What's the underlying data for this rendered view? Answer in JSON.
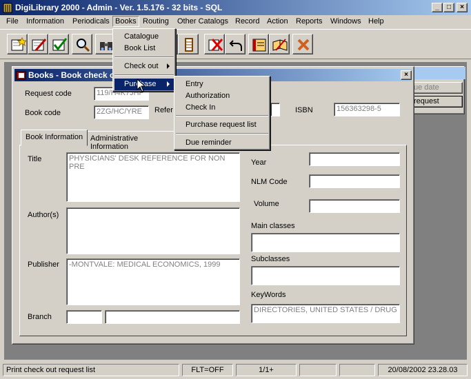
{
  "app": {
    "title": "DigiLibrary 2000 - Admin - Ver. 1.5.176 - 32 bits - SQL",
    "controls": {
      "minimize": "_",
      "maximize": "□",
      "close": "×"
    }
  },
  "menubar": [
    "File",
    "Information",
    "Periodicals",
    "Books",
    "Routing",
    "Other Catalogs",
    "Record",
    "Action",
    "Reports",
    "Windows",
    "Help"
  ],
  "toolbar": {
    "icons": [
      "new-card-icon",
      "edit-card-icon",
      "check-card-icon",
      "magnifier-icon",
      "binoculars-icon",
      "tool-icon",
      "filmstrip-icon",
      "delete-icon",
      "undo-icon",
      "book-icon",
      "open-book-icon",
      "cancel-icon"
    ]
  },
  "books_menu": {
    "items": [
      "Catalogue",
      "Book List",
      "Check out",
      "Purchase"
    ]
  },
  "purchase_menu": {
    "items": [
      "Entry",
      "Authorization",
      "Check In",
      "Purchase request list",
      "Due reminder"
    ]
  },
  "bg_window": {
    "buttons": [
      "ue date",
      "request"
    ]
  },
  "child": {
    "title": "Books - Book check out",
    "close": "×",
    "request_code_label": "Request code",
    "request_code_value": "119/H4K7JHP",
    "book_code_label": "Book code",
    "book_code_value": "2ZG/HC/YRE",
    "reference_label": "Refer",
    "isbn_label": "ISBN",
    "isbn_value": "156363298-5",
    "tabs": [
      "Book Information",
      "Administrative Information"
    ],
    "title_label": "Title",
    "title_value": "PHYSICIANS' DESK REFERENCE FOR NON PRE",
    "authors_label": "Author(s)",
    "authors_value": "",
    "publisher_label": "Publisher",
    "publisher_value": "-MONTVALE: MEDICAL ECONOMICS, 1999",
    "branch_label": "Branch",
    "year_label": "Year",
    "nlm_label": "NLM Code",
    "volume_label": "Volume",
    "main_classes_label": "Main classes",
    "subclasses_label": "Subclasses",
    "keywords_label": "KeyWords",
    "keywords_value": "DIRECTORIES, UNITED STATES / DRUG"
  },
  "statusbar": {
    "message": "Print check out request list",
    "flt": "FLT=OFF",
    "page": "1/1+",
    "datetime": "20/08/2002 23.28.03"
  },
  "colors": {
    "title_active": "#0a246a",
    "title_fade": "#a6caf0",
    "face": "#d4d0c8",
    "mdi": "#808080"
  }
}
